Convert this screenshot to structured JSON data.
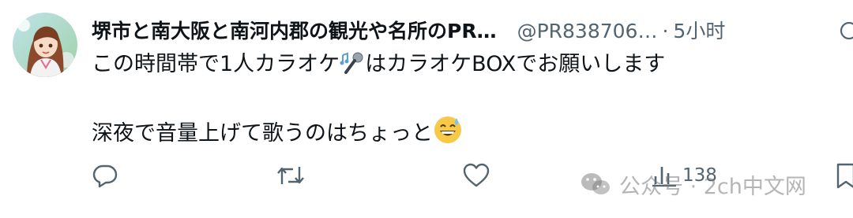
{
  "tweet": {
    "display_name": "堺市と南大阪と南河内郡の観光や名所のPR…",
    "handle": "@PR838706…",
    "separator": "·",
    "time": "5小时",
    "text_line1": "この時間帯で1人カラオケ",
    "text_line1_after": "はカラオケBOXでお願いします",
    "text_line2": "深夜で音量上げて歌うのはちょっと",
    "emoji_mic": "microphone-emoji",
    "emoji_sweat": "grinning-sweat-emoji"
  },
  "actions": {
    "views": "138"
  },
  "watermark": {
    "text": "公众号 · 2ch中文网"
  },
  "colors": {
    "text": "#0f1419",
    "secondary": "#536471"
  }
}
